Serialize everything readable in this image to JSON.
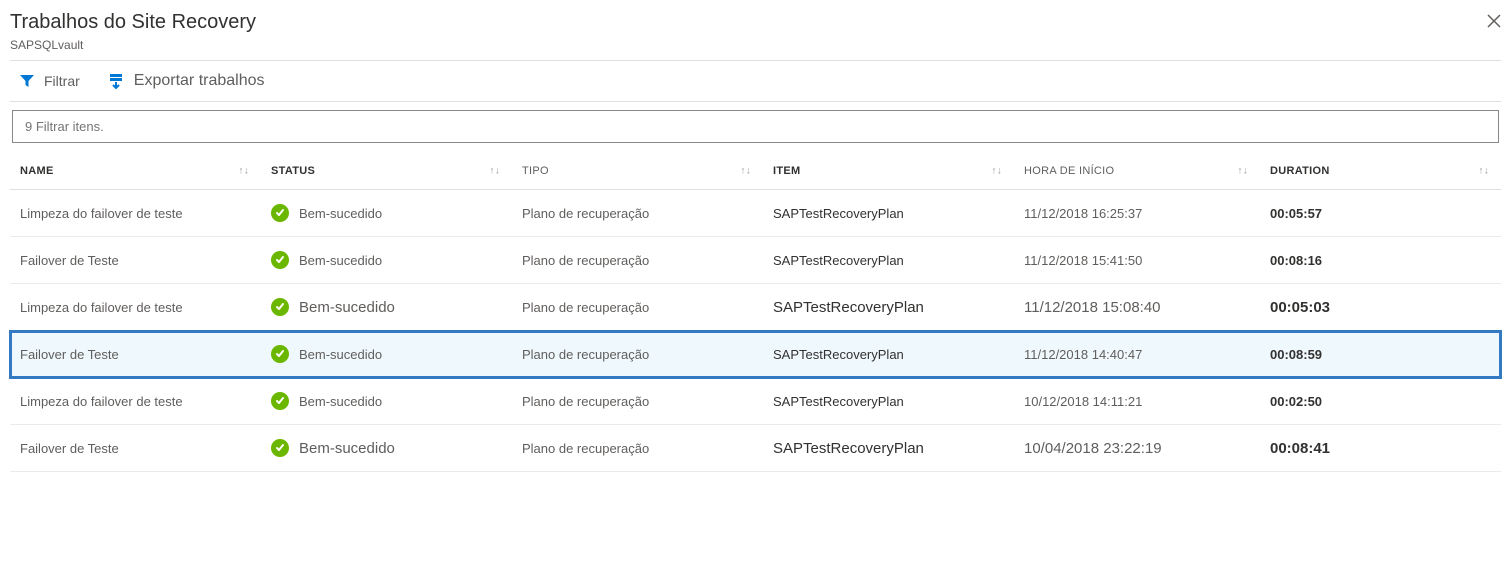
{
  "header": {
    "title": "Trabalhos do Site Recovery",
    "subtitle": "SAPSQLvault"
  },
  "toolbar": {
    "filter_label": "Filtrar",
    "export_label": "Exportar trabalhos"
  },
  "filter": {
    "placeholder": "9 Filtrar itens."
  },
  "columns": {
    "name": "NAME",
    "status": "STATUS",
    "type": "TIPO",
    "item": "ITEM",
    "start": "HORA DE INÍCIO",
    "duration": "DURATION"
  },
  "status_labels": {
    "success": "Bem-sucedido"
  },
  "rows": [
    {
      "name": "Limpeza do failover de teste",
      "status": "success",
      "type": "Plano de recuperação",
      "item": "SAPTestRecoveryPlan",
      "start": "11/12/2018 16:25:37",
      "duration": "00:05:57",
      "selected": false,
      "big": false
    },
    {
      "name": "Failover de Teste",
      "status": "success",
      "type": "Plano de recuperação",
      "item": "SAPTestRecoveryPlan",
      "start": "11/12/2018 15:41:50",
      "duration": "00:08:16",
      "selected": false,
      "big": false
    },
    {
      "name": "Limpeza do failover de teste",
      "status": "success",
      "type": "Plano de recuperação",
      "item": "SAPTestRecoveryPlan",
      "start": "11/12/2018 15:08:40",
      "duration": "00:05:03",
      "selected": false,
      "big": true
    },
    {
      "name": "Failover de Teste",
      "status": "success",
      "type": "Plano de recuperação",
      "item": "SAPTestRecoveryPlan",
      "start": "11/12/2018 14:40:47",
      "duration": "00:08:59",
      "selected": true,
      "big": false
    },
    {
      "name": "Limpeza do failover de teste",
      "status": "success",
      "type": "Plano de recuperação",
      "item": "SAPTestRecoveryPlan",
      "start": "10/12/2018 14:11:21",
      "duration": "00:02:50",
      "selected": false,
      "big": false
    },
    {
      "name": "Failover de Teste",
      "status": "success",
      "type": "Plano de recuperação",
      "item": "SAPTestRecoveryPlan",
      "start": "10/04/2018 23:22:19",
      "duration": "00:08:41",
      "selected": false,
      "big": true
    }
  ]
}
